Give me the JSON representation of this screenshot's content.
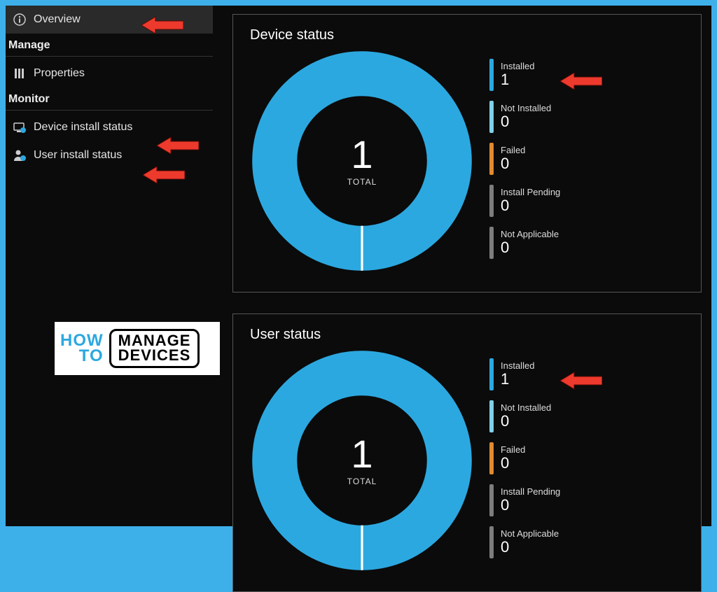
{
  "sidebar": {
    "items": [
      {
        "label": "Overview"
      },
      {
        "section": "Manage"
      },
      {
        "label": "Properties"
      },
      {
        "section": "Monitor"
      },
      {
        "label": "Device install status"
      },
      {
        "label": "User install status"
      }
    ]
  },
  "device_status": {
    "title": "Device status",
    "total_value": "1",
    "total_label": "TOTAL",
    "legend": {
      "installed": {
        "label": "Installed",
        "value": "1",
        "color": "#2ca8e0"
      },
      "not_installed": {
        "label": "Not Installed",
        "value": "0",
        "color": "#7fd0e8"
      },
      "failed": {
        "label": "Failed",
        "value": "0",
        "color": "#e18a2e"
      },
      "install_pending": {
        "label": "Install Pending",
        "value": "0",
        "color": "#7d7d7d"
      },
      "not_applicable": {
        "label": "Not Applicable",
        "value": "0",
        "color": "#7d7d7d"
      }
    }
  },
  "user_status": {
    "title": "User status",
    "total_value": "1",
    "total_label": "TOTAL",
    "legend": {
      "installed": {
        "label": "Installed",
        "value": "1",
        "color": "#2ca8e0"
      },
      "not_installed": {
        "label": "Not Installed",
        "value": "0",
        "color": "#7fd0e8"
      },
      "failed": {
        "label": "Failed",
        "value": "0",
        "color": "#e18a2e"
      },
      "install_pending": {
        "label": "Install Pending",
        "value": "0",
        "color": "#7d7d7d"
      },
      "not_applicable": {
        "label": "Not Applicable",
        "value": "0",
        "color": "#7d7d7d"
      }
    }
  },
  "logo": {
    "how": "HOW",
    "to": "TO",
    "manage": "MANAGE",
    "devices": "DEVICES"
  },
  "colors": {
    "ring": "#2ca8e0",
    "frame_border": "#3db0ea",
    "arrow": "#ed3a2d"
  },
  "chart_data": [
    {
      "type": "pie",
      "title": "Device status",
      "categories": [
        "Installed",
        "Not Installed",
        "Failed",
        "Install Pending",
        "Not Applicable"
      ],
      "values": [
        1,
        0,
        0,
        0,
        0
      ],
      "total": 1
    },
    {
      "type": "pie",
      "title": "User status",
      "categories": [
        "Installed",
        "Not Installed",
        "Failed",
        "Install Pending",
        "Not Applicable"
      ],
      "values": [
        1,
        0,
        0,
        0,
        0
      ],
      "total": 1
    }
  ]
}
